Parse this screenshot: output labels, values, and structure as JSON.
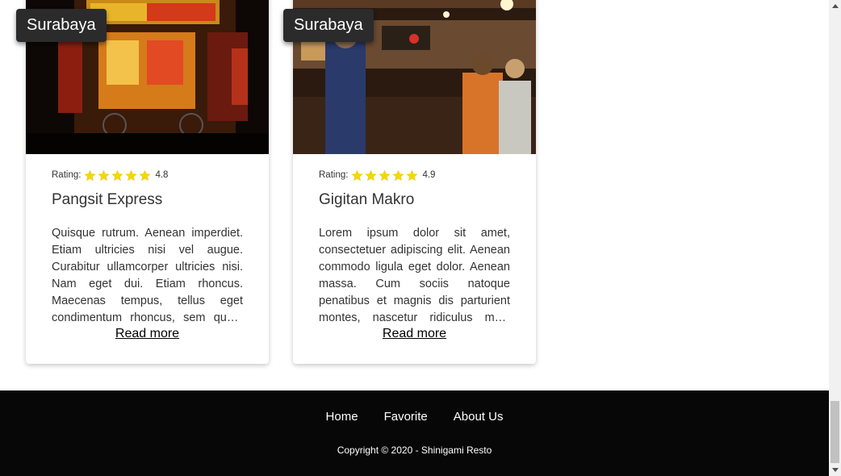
{
  "cards": [
    {
      "city": "Surabaya",
      "rating_label": "Rating:",
      "rating": "4.8",
      "name": "Pangsit Express",
      "description": "Quisque rutrum. Aenean imperdiet. Etiam ultricies nisi vel augue. Curabitur ullamcorper ultricies nisi. Nam eget dui. Etiam rhoncus. Maecenas tempus, tellus eget condimentum rhoncus, sem quam semper libero.",
      "read_more": "Read more",
      "image_icon": "ramen-shop-night-photo"
    },
    {
      "city": "Surabaya",
      "rating_label": "Rating:",
      "rating": "4.9",
      "name": "Gigitan Makro",
      "description": "Lorem ipsum dolor sit amet, consectetuer adipiscing elit. Aenean commodo ligula eget dolor. Aenean massa. Cum sociis natoque penatibus et magnis dis parturient montes, nascetur ridiculus mus. Donec quam felis.",
      "read_more": "Read more",
      "image_icon": "busy-bar-interior-photo"
    }
  ],
  "footer": {
    "nav": [
      "Home",
      "Favorite",
      "About Us"
    ],
    "copyright": "Copyright © 2020 - Shinigami Resto"
  },
  "colors": {
    "star": "#f5d800",
    "footer_bg": "#070707",
    "tag_bg": "#2b2b2b"
  }
}
